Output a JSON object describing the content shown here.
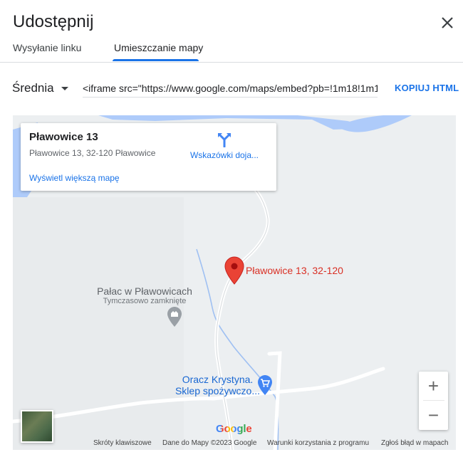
{
  "dialog": {
    "title": "Udostępnij",
    "tabs": [
      {
        "label": "Wysyłanie linku",
        "active": false
      },
      {
        "label": "Umieszczanie mapy",
        "active": true
      }
    ]
  },
  "embed": {
    "size_label": "Średnia",
    "code": "<iframe src=\"https://www.google.com/maps/embed?pb=!1m18!1m12",
    "copy_label": "KOPIUJ HTML"
  },
  "map": {
    "info_card": {
      "name": "Pławowice 13",
      "address": "Pławowice 13, 32-120 Pławowice",
      "directions_label": "Wskazówki doja...",
      "larger_map_label": "Wyświetl większą mapę"
    },
    "marker_label": "Pławowice 13, 32-120",
    "poi_palace": {
      "name": "Pałac w Pławowicach",
      "status": "Tymczasowo zamknięte"
    },
    "poi_shop": {
      "line1": "Oracz Krystyna.",
      "line2": "Sklep spożywczo..."
    },
    "zoom_in": "+",
    "zoom_out": "−",
    "logo": "Google",
    "attribution": {
      "shortcuts": "Skróty klawiszowe",
      "data": "Dane do Mapy ©2023 Google",
      "terms": "Warunki korzystania z programu",
      "report": "Zgłoś błąd w mapach"
    }
  },
  "colors": {
    "accent": "#1a73e8",
    "marker": "#ea4335",
    "water": "#aecbfa",
    "map_bg": "#eceff1"
  },
  "icons": [
    "close-icon",
    "caret-down-icon",
    "directions-icon",
    "map-pin-icon",
    "palace-icon",
    "shopping-cart-icon",
    "satellite-layer-icon"
  ]
}
